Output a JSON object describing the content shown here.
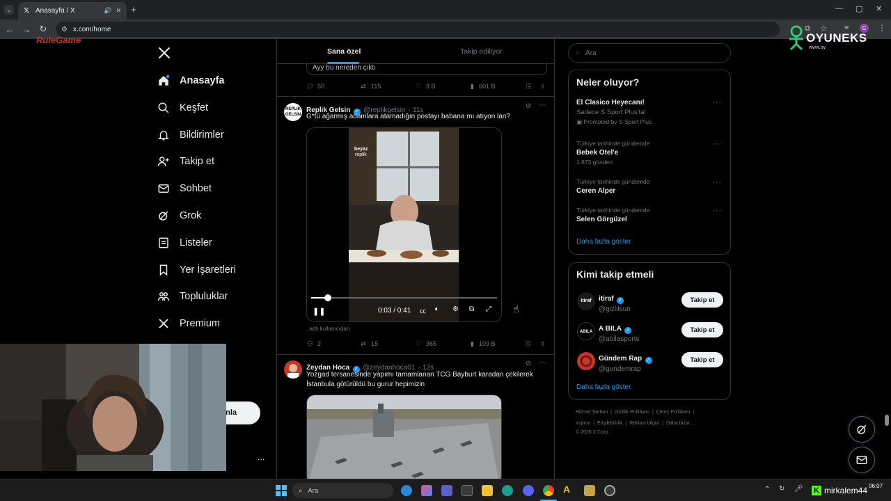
{
  "browser": {
    "tab_title": "Anasayfa / X",
    "url": "x.com/home"
  },
  "overlay": {
    "brand_left": "RuleGame",
    "brand_right": "OYUNEKS",
    "brand_right_sub": "www.oy",
    "streamer_name": "mirkalem44",
    "clock_time": "06:07"
  },
  "nav": {
    "items": [
      {
        "label": "Anasayfa",
        "icon": "home-icon"
      },
      {
        "label": "Keşfet",
        "icon": "search-icon"
      },
      {
        "label": "Bildirimler",
        "icon": "bell-icon"
      },
      {
        "label": "Takip et",
        "icon": "person-add-icon"
      },
      {
        "label": "Sohbet",
        "icon": "mail-icon"
      },
      {
        "label": "Grok",
        "icon": "grok-icon"
      },
      {
        "label": "Listeler",
        "icon": "list-icon"
      },
      {
        "label": "Yer İşaretleri",
        "icon": "bookmark-icon"
      },
      {
        "label": "Topluluklar",
        "icon": "communities-icon"
      },
      {
        "label": "Premium",
        "icon": "x-logo-icon"
      }
    ],
    "post_button_partial": "nla",
    "more_dots": "..."
  },
  "timeline": {
    "tabs": [
      "Sana özel",
      "Takip ediliyor"
    ],
    "prev_tweet": {
      "text_partial": "Ayy bu nereden çıktı",
      "replies": "50",
      "reposts": "115",
      "likes": "3 B",
      "views": "601 B"
    },
    "tweet1": {
      "name": "Replik Gelsin",
      "handle": "@replikgelsin",
      "time": "· 11s",
      "text": "G*tü ağarmış adamlara atamadığın postayı babana mı atıyon lan?",
      "video_watermark": "beyaz",
      "video_watermark2": "replik",
      "video_time": "0:03 / 0:41",
      "video_progress": 0.09,
      "caption": ". adlı kullanıcıdan",
      "replies": "2",
      "reposts": "15",
      "likes": "365",
      "views": "109 B"
    },
    "tweet2": {
      "name": "Zeydan Hoca",
      "handle": "@zeydanhoca01",
      "time": "· 12s",
      "text_line1": "Yozgad tersanesinde yapımı tamamlanan TCG Bayburt karadan çekilerek",
      "text_line2": "İstanbula götürüldü bu gurur hepimizin"
    }
  },
  "sidebar": {
    "search_placeholder": "Ara",
    "trends_title": "Neler oluyor?",
    "trends": [
      {
        "category": "",
        "name": "El Clasico Heyecanı!",
        "sub": "Sadece S Sport Plus'ta!",
        "meta": "Promoted by S Sport Plus"
      },
      {
        "category": "Türkiye tarihinde gündemde",
        "name": "Bebek Otel'e",
        "meta": "1.873 gönderi"
      },
      {
        "category": "Türkiye tarihinde gündemde",
        "name": "Ceren Alper",
        "meta": ""
      },
      {
        "category": "Türkiye tarihinde gündemde",
        "name": "Selen Görgüzel",
        "meta": ""
      }
    ],
    "show_more": "Daha fazla göster",
    "who_to_follow_title": "Kimi takip etmeli",
    "follows": [
      {
        "name": "itiraf",
        "handle": "@gizlilsun",
        "button": "Takip et",
        "avatar_text": "itiraf"
      },
      {
        "name": "A BILA",
        "handle": "@abilasports",
        "button": "Takip et",
        "avatar_text": "ABILA"
      },
      {
        "name": "Gündem Rap",
        "handle": "@gundemrap",
        "button": "Takip et",
        "avatar_text": ""
      }
    ],
    "show_more2": "Daha fazla göster",
    "footer_line1": [
      "Hizmet Şartları",
      "Gizlilik Politikası",
      "Çerez Politikası"
    ],
    "footer_line2": [
      "Imprint",
      "Erişilebilirlik",
      "Reklam bilgisi",
      "Daha fazla ..."
    ],
    "copyright": "© 2026 X Corp."
  },
  "taskbar": {
    "search_placeholder": "Ara"
  },
  "colors": {
    "accent": "#1d9bf0",
    "border": "#2f3336",
    "muted": "#71767b"
  }
}
